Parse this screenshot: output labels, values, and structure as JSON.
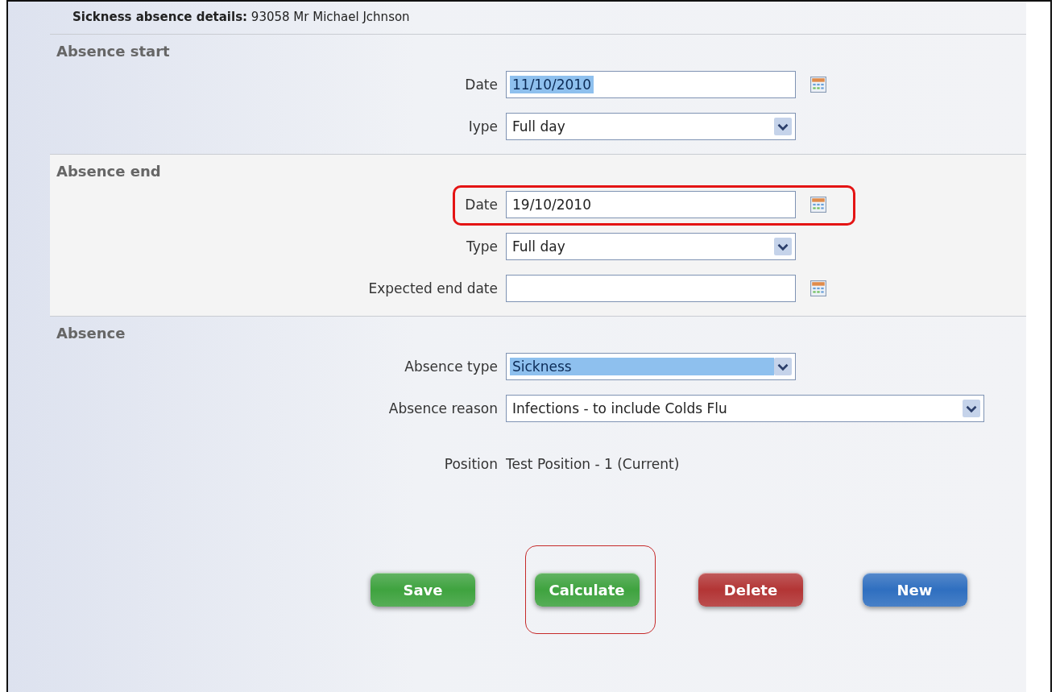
{
  "header": {
    "label": "Sickness absence details:",
    "value": "93058 Mr Michael Jchnson"
  },
  "sections": [
    {
      "title": "Absence start",
      "fields": [
        {
          "kind": "date",
          "label": "Date",
          "value": "11/10/2010",
          "text_selected": true
        },
        {
          "kind": "select",
          "label": "Iype",
          "value": "Full day"
        }
      ]
    },
    {
      "title": "Absence end",
      "fields": [
        {
          "kind": "date",
          "label": "Date",
          "value": "19/10/2010",
          "highlighted": true
        },
        {
          "kind": "select",
          "label": "Type",
          "value": "Full day"
        },
        {
          "kind": "date",
          "label": "Expected end date"
        }
      ]
    },
    {
      "title": "Absence",
      "fields": [
        {
          "kind": "select",
          "label": "Absence type",
          "value": "Sickness",
          "text_selected": true
        },
        {
          "kind": "select_wide",
          "label": "Absence reason",
          "value": "Infections - to include Colds Flu"
        },
        {
          "kind": "text",
          "label": "Position",
          "value": "Test Position - 1 (Current)"
        }
      ]
    }
  ],
  "buttons": [
    {
      "label": "Save",
      "color": "#3fa33f",
      "highlighted": false
    },
    {
      "label": "Calculate",
      "color": "#3fa33f",
      "highlighted": true
    },
    {
      "label": "Delete",
      "color": "#b33535",
      "highlighted": false
    },
    {
      "label": "New",
      "color": "#2f6fc0",
      "highlighted": false
    }
  ]
}
